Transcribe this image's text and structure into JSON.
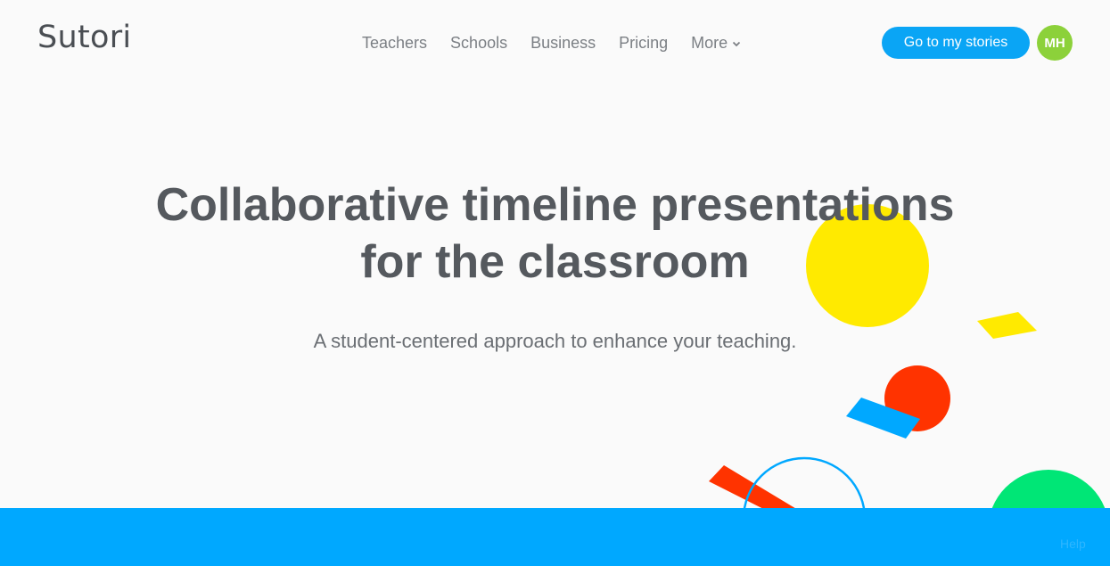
{
  "brand": {
    "logo_text": "Sutori"
  },
  "nav": {
    "items": [
      {
        "label": "Teachers"
      },
      {
        "label": "Schools"
      },
      {
        "label": "Business"
      },
      {
        "label": "Pricing"
      },
      {
        "label": "More"
      }
    ]
  },
  "header": {
    "cta_label": "Go to my stories",
    "avatar_initials": "MH"
  },
  "hero": {
    "title_line1": "Collaborative timeline presentations",
    "title_line2": "for the classroom",
    "subtitle": "A student-centered approach to enhance your teaching."
  },
  "footer": {
    "help_label": "Help"
  },
  "colors": {
    "accent_blue": "#00a8ff",
    "button_blue": "#0aa5f5",
    "avatar_green": "#8cd13a",
    "shape_yellow": "#ffea00",
    "shape_red": "#ff3300",
    "shape_blue": "#00a8ff",
    "shape_green": "#00e676",
    "background": "#fafafa"
  },
  "icons": {
    "more_menu": "chevron-down-icon"
  }
}
